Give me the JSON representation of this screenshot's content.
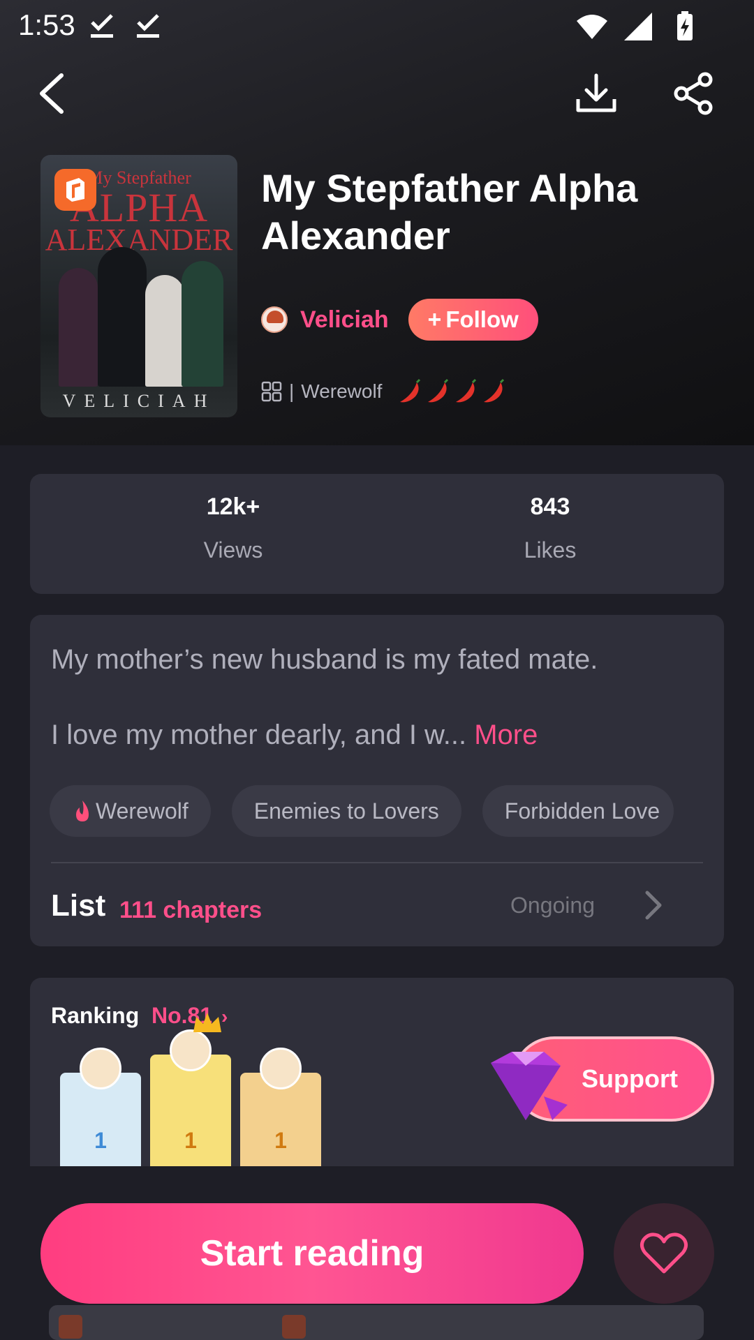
{
  "status_bar": {
    "time": "1:53"
  },
  "book": {
    "title": "My Stepfather Alpha Alexander",
    "cover": {
      "line1": "My Stepfather",
      "line2": "ALPHA",
      "line3": "ALEXANDER",
      "author": "VELICIAH"
    },
    "author": "Veliciah",
    "follow_label": "Follow",
    "genre": "Werewolf",
    "heat_level": 4
  },
  "stats": [
    {
      "value": "12k+",
      "label": "Views"
    },
    {
      "value": "843",
      "label": "Likes"
    }
  ],
  "description": {
    "line1": "My mother’s new husband is my fated mate.",
    "line2": "I love my mother dearly, and I w...",
    "more": "More"
  },
  "tags": [
    "Werewolf",
    "Enemies to Lovers",
    "Forbidden Love"
  ],
  "chapters": {
    "label": "List",
    "count": "111 chapters",
    "status": "Ongoing"
  },
  "ranking": {
    "label": "Ranking",
    "rank": "No.81",
    "podium": [
      "1",
      "1",
      "1"
    ],
    "support_label": "Support"
  },
  "cta": {
    "start_label": "Start reading"
  },
  "colors": {
    "accent": "#ff4f8a",
    "follow": "#ff6473",
    "card": "#2f2f3a",
    "background": "#1e1e26"
  }
}
